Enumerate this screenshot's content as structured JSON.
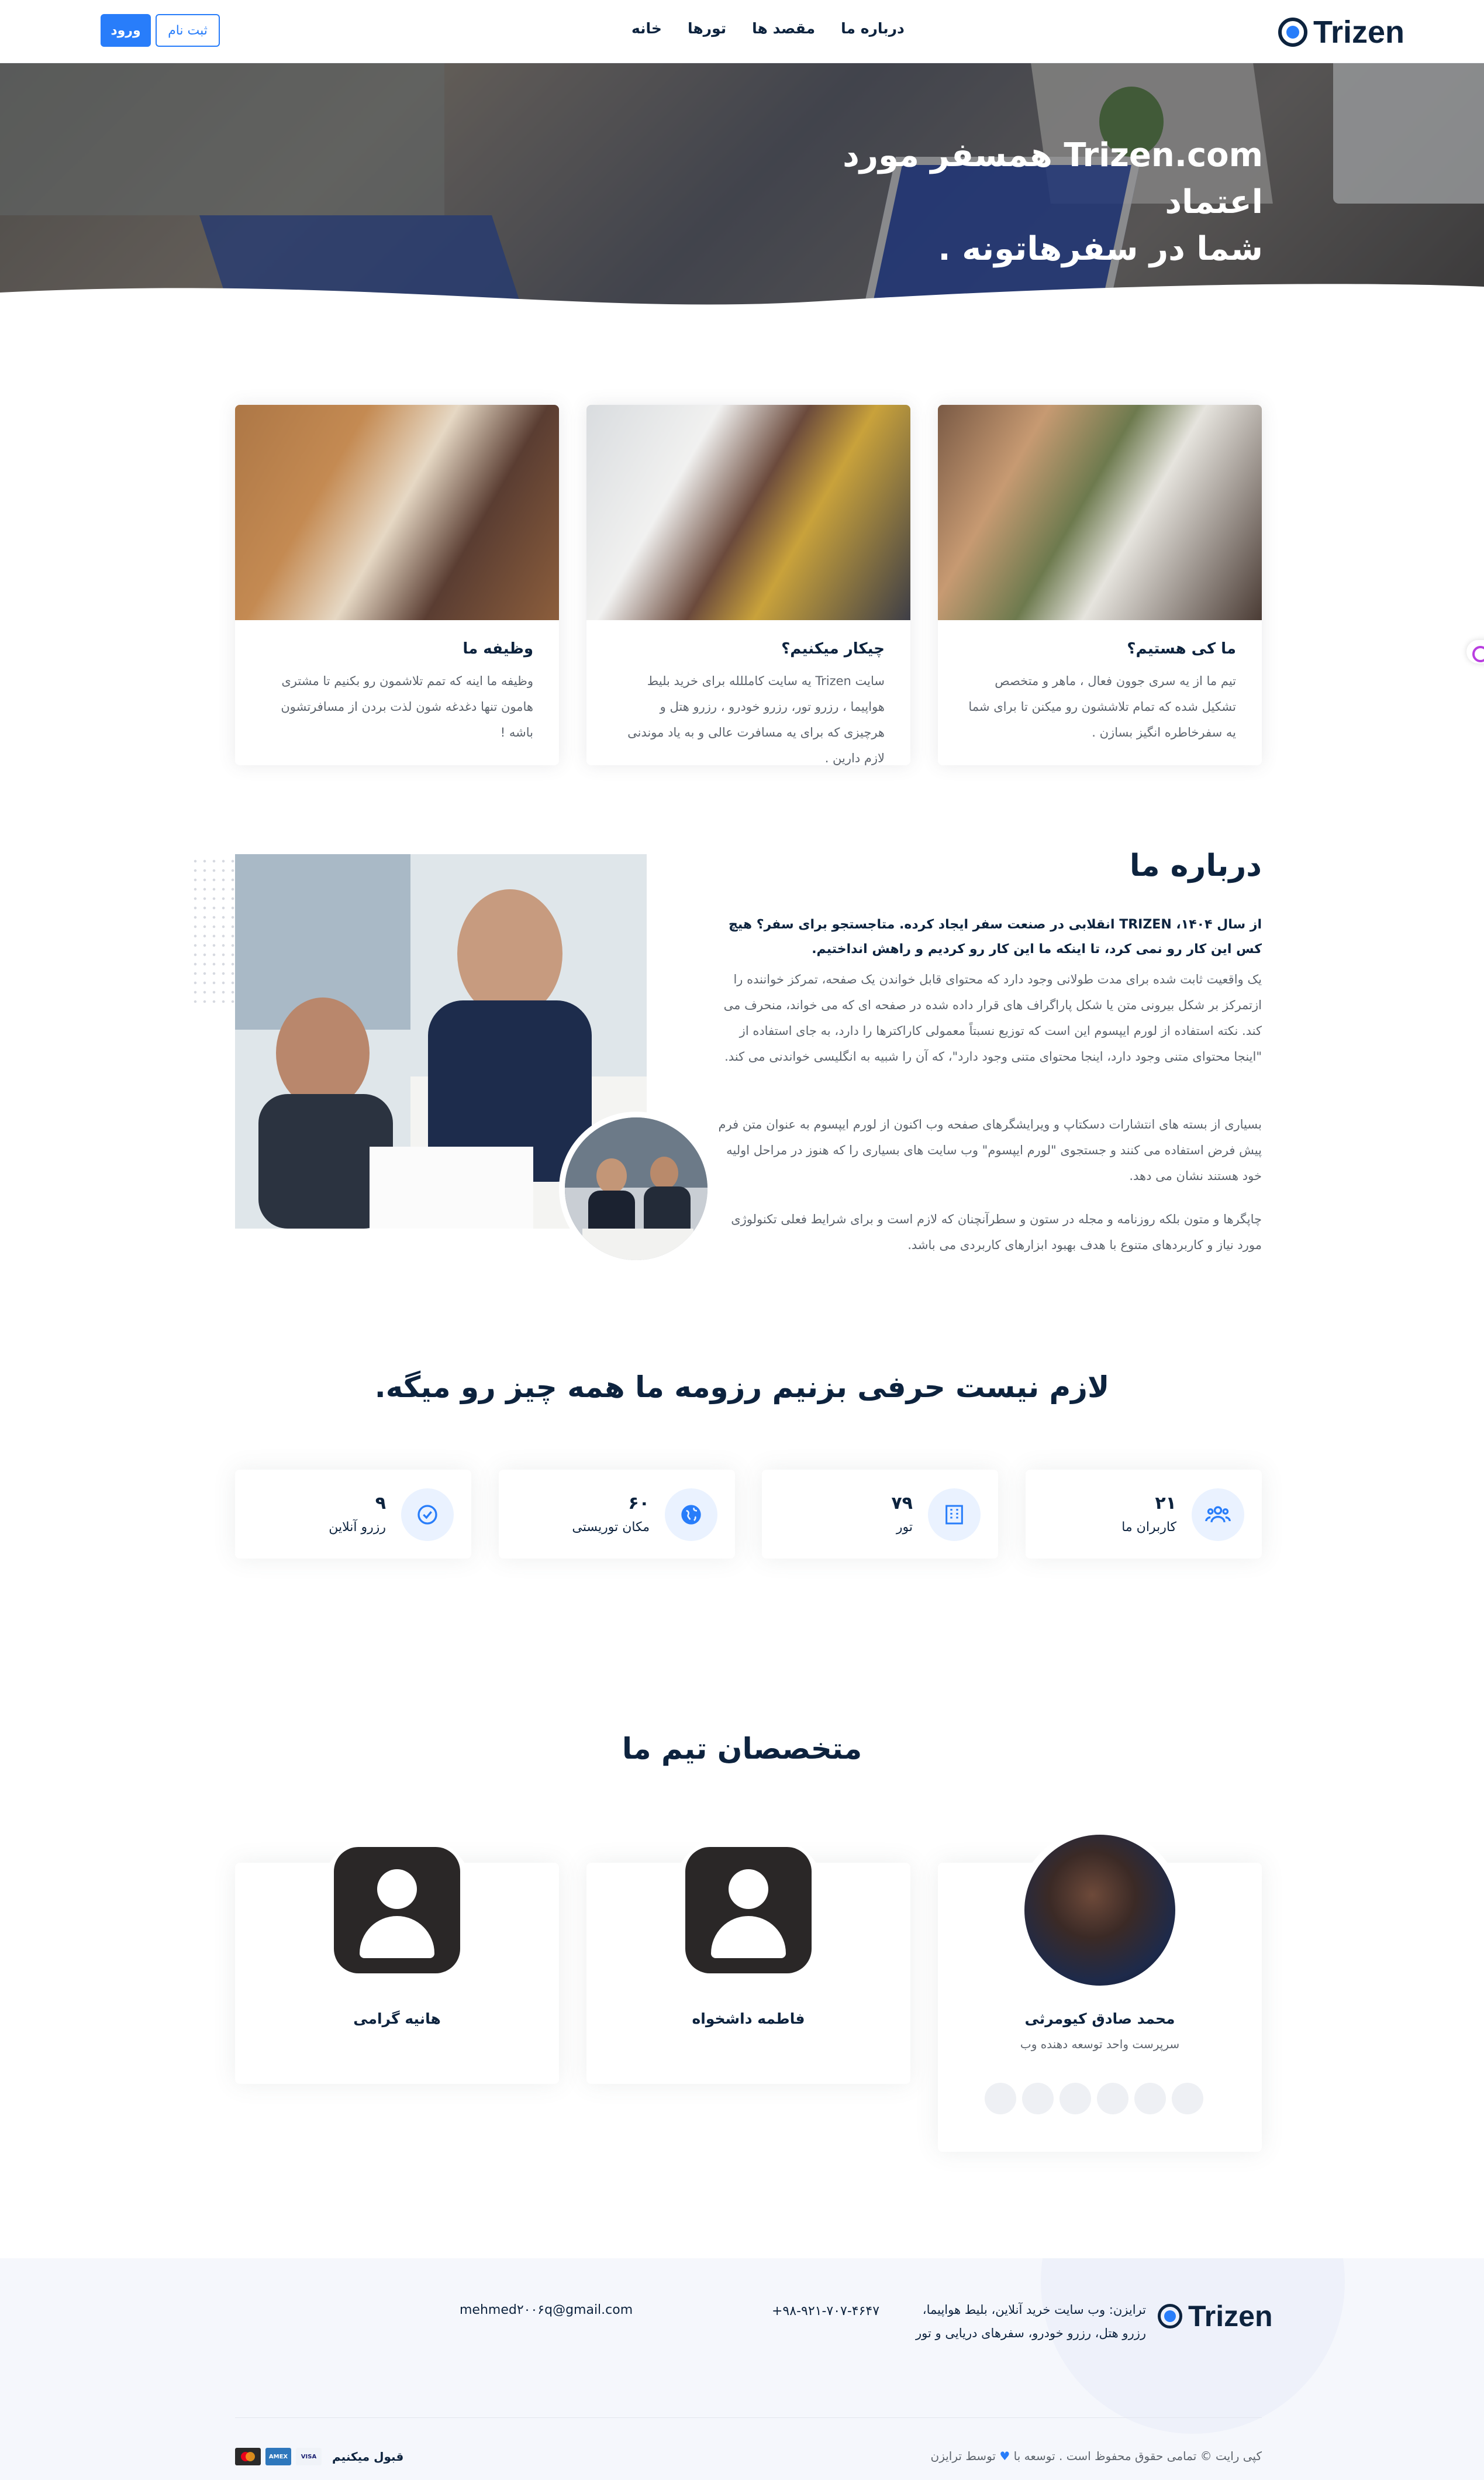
{
  "header": {
    "brand": "Trizen",
    "nav": [
      "خانه",
      "تورها",
      "مقصد ها",
      "درباره ما"
    ],
    "login_label": "ورود",
    "signup_label": "ثبت نام"
  },
  "hero": {
    "title_line1": "Trizen.com همسفر مورد اعتماد",
    "title_line2": "شما در سفرهاتونه ."
  },
  "cards": [
    {
      "title": "ما کی هستیم؟",
      "text": "تیم ما از یه سری جوون فعال ، ماهر و متخصص تشکیل شده که تمام تلاششون رو میکنن تا برای شما یه سفرخاطره انگیز بسازن ."
    },
    {
      "title": "چیکار میکنیم؟",
      "text": "سایت Trizen یه سایت کامللله برای خرید بلیط هواپیما ، رزرو تور، رزرو خودرو ، رزرو هتل و هرچیزی که برای یه مسافرت عالی و به یاد موندنی لازم دارین ."
    },
    {
      "title": "وظیفه ما",
      "text": "وظیفه ما اینه که تمم تلاشمون رو بکنیم تا مشتری هامون تنها دغدغه شون لذت بردن از مسافرتشون باشه !"
    }
  ],
  "about": {
    "title": "درباره ما",
    "lead": "از سال ۱۴۰۴، TRIZEN انقلابی در صنعت سفر ایجاد کرده. متاجستجو برای سفر؟ هیچ کس این کار رو نمی کرد، تا اینکه ما این کار رو کردیم و راهش انداختیم.",
    "p1": "یک واقعیت ثابت شده برای مدت طولانی وجود دارد که محتوای قابل خواندن یک صفحه، تمرکز خواننده را ازتمرکز بر شکل بیرونی متن یا شکل پاراگراف های قرار داده شده در صفحه ای که می خواند، منحرف می کند. نکته استفاده از لورم ایپسوم این است که توزیع نسبتاً معمولی کاراکترها را دارد، به جای استفاده از \"اینجا محتوای متنی وجود دارد، اینجا محتوای متنی وجود دارد\"، که آن را شبیه به انگلیسی خواندنی می کند.",
    "p2": "بسیاری از بسته های انتشارات دسکتاپ و ویرایشگرهای صفحه وب اکنون از لورم ایپسوم به عنوان متن فرم پیش فرض استفاده می کنند و جستجوی \"لورم ایپسوم\" وب سایت های بسیاری را که هنوز در مراحل اولیه خود هستند نشان می دهد.",
    "p3": "چاپگرها و متون بلکه روزنامه و مجله در ستون و سطرآنچنان که لازم است و برای شرایط فعلی تکنولوژی مورد نیاز و کاربردهای متنوع با هدف بهبود ابزارهای کاربردی می باشد."
  },
  "stats": {
    "title": "لازم نیست حرفی بزنیم رزومه ما همه چیز رو میگه.",
    "items": [
      {
        "number": "۲۱",
        "label": "کاربران ما",
        "icon": "users-icon"
      },
      {
        "number": "۷۹",
        "label": "تور",
        "icon": "building-icon"
      },
      {
        "number": "۶۰",
        "label": "مکان توریستی",
        "icon": "globe-icon"
      },
      {
        "number": "۹",
        "label": "رزرو آنلاین",
        "icon": "check-circle-icon"
      }
    ]
  },
  "team": {
    "title": "متخصصان تیم ما",
    "members": [
      {
        "name": "محمد صادق کیومرثی",
        "role": "سرپرست واحد توسعه دهنده وب"
      },
      {
        "name": "فاطمه داشخواه",
        "role": ""
      },
      {
        "name": "هانیه گرامی",
        "role": ""
      }
    ]
  },
  "footer": {
    "brand": "Trizen",
    "description": "ترایزن: وب سایت خرید آنلاین، بلیط هواپیما، رزرو هتل، رزرو خودرو، سفرهای دریایی و تور",
    "phone": "+۹۸-۹۲۱-۷۰۷-۴۶۴۷",
    "email": "mehmed۲۰۰۶q@gmail.com",
    "copyright_prefix": "کپی رایت © تمامی حقوق محفوظ است . توسعه با",
    "copyright_suffix": "توسط ترایزن",
    "payments_label": "قبول میکنیم",
    "payment_cards": [
      "VISA",
      "AMEX",
      "MC"
    ]
  },
  "colors": {
    "accent": "#287dfa",
    "dark": "#0d233e",
    "muted": "#5d646d",
    "footer_bg": "#f5f7fc"
  }
}
